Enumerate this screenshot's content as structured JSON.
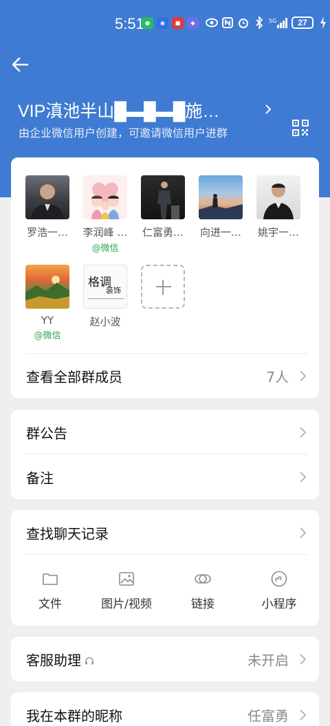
{
  "status_bar": {
    "time": "5:51",
    "battery": "27"
  },
  "header": {
    "title": "VIP滇池半山█▬█▬█施…",
    "subtitle": "由企业微信用户创建，可邀请微信用户进群"
  },
  "members": [
    {
      "name": "罗浩一…",
      "tag": ""
    },
    {
      "name": "李润峰 …",
      "tag": "@微信"
    },
    {
      "name": "仁富勇…",
      "tag": ""
    },
    {
      "name": "向进一…",
      "tag": ""
    },
    {
      "name": "姚宇一…",
      "tag": ""
    },
    {
      "name": "YY",
      "tag": "@微信"
    },
    {
      "name": "赵小波",
      "tag": ""
    }
  ],
  "view_all": {
    "label": "查看全部群成员",
    "value": "7人"
  },
  "announcement": {
    "label": "群公告"
  },
  "remark": {
    "label": "备注"
  },
  "search_history": {
    "label": "查找聊天记录"
  },
  "tools": [
    {
      "label": "文件",
      "icon": "folder-icon"
    },
    {
      "label": "图片/视频",
      "icon": "image-icon"
    },
    {
      "label": "链接",
      "icon": "link-icon"
    },
    {
      "label": "小程序",
      "icon": "mini-program-icon"
    }
  ],
  "service": {
    "label": "客服助理",
    "value": "未开启"
  },
  "nickname": {
    "label": "我在本群的昵称",
    "value": "任富勇"
  },
  "colors": {
    "header": "#3f7bd2",
    "wechat_green": "#2aa553",
    "background": "#efeff2"
  },
  "avatar_logo_text": {
    "line1": "格调",
    "line2": "装饰"
  }
}
